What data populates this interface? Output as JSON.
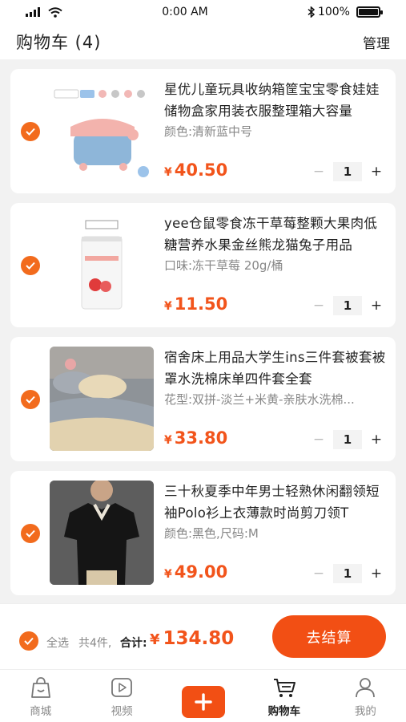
{
  "status_bar": {
    "time": "0:00 AM",
    "battery": "100%"
  },
  "header": {
    "title": "购物车 (4)",
    "manage": "管理"
  },
  "items": [
    {
      "title": "星优儿童玩具收纳箱筐宝宝零食娃娃储物盒家用装衣服整理箱大容量",
      "spec": "颜色:清新蓝中号",
      "currency": "¥",
      "price": "40.50",
      "quantity": "1",
      "selected": true
    },
    {
      "title": "yee仓鼠零食冻干草莓整颗大果肉低糖营养水果金丝熊龙猫兔子用品",
      "spec": "口味:冻干草莓 20g/桶",
      "currency": "¥",
      "price": "11.50",
      "quantity": "1",
      "selected": true
    },
    {
      "title": "宿舍床上用品大学生ins三件套被套被罩水洗棉床单四件套全套",
      "spec": "花型:双拼-淡兰+米黄-亲肤水洗棉...",
      "currency": "¥",
      "price": "33.80",
      "quantity": "1",
      "selected": true
    },
    {
      "title": "三十秋夏季中年男士轻熟休闲翻领短袖Polo衫上衣薄款时尚剪刀领T",
      "spec": "颜色:黑色,尺码:M",
      "currency": "¥",
      "price": "49.00",
      "quantity": "1",
      "selected": true
    }
  ],
  "stepper": {
    "minus": "−",
    "plus": "+"
  },
  "checkout": {
    "select_all": "全选",
    "count_text": "共4件,",
    "total_label": "合计:",
    "currency": "¥",
    "total": "134.80",
    "button": "去结算"
  },
  "tabs": [
    {
      "label": "商城",
      "icon": "shop-bag-icon"
    },
    {
      "label": "视频",
      "icon": "video-play-icon"
    },
    {
      "label": "",
      "icon": "plus-icon"
    },
    {
      "label": "购物车",
      "icon": "cart-icon"
    },
    {
      "label": "我的",
      "icon": "user-icon"
    }
  ],
  "colors": {
    "accent": "#f24f14",
    "price": "#f2541b",
    "check": "#f26b1d"
  }
}
